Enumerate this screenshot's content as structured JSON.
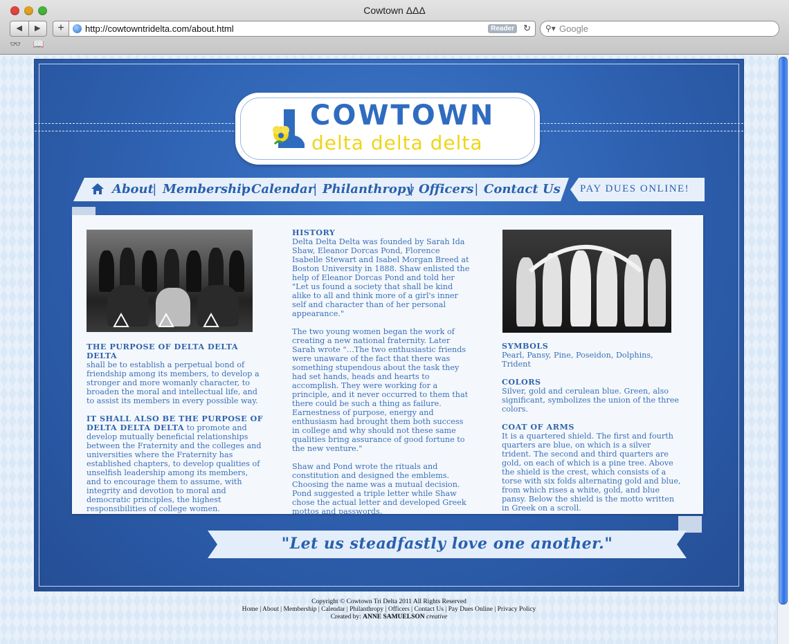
{
  "window": {
    "title": "Cowtown ΔΔΔ"
  },
  "toolbar": {
    "back_label": "◀",
    "forward_label": "▶",
    "add_label": "+",
    "url": "http://cowtowntridelta.com/about.html",
    "reader_label": "Reader",
    "reload_label": "↻",
    "search_placeholder": "Google",
    "bookmarks": [
      "👓",
      "📖"
    ]
  },
  "logo": {
    "line1": "COWTOWN",
    "line2": "delta delta delta"
  },
  "nav": {
    "items": [
      "About",
      "Membership",
      "Calendar",
      "Philanthropy",
      "Officers",
      "Contact Us"
    ],
    "separator": "|",
    "paydues_label": "PAY DUES ONLINE!"
  },
  "left_col": {
    "h1": "THE PURPOSE OF DELTA DELTA DELTA",
    "p1": "shall be to establish a perpetual bond of friendship among its members, to develop a stronger and more womanly character, to broaden the moral and intellectual life, and to assist its members in every possible way.",
    "h2": "IT SHALL ALSO BE THE PURPOSE OF DELTA DELTA DELTA",
    "p2": " to promote and develop mutually beneficial relationships between the Fraternity and the colleges and universities where the Fraternity has established chapters, to develop qualities of unselfish leadership among its members, and to encourage them to assume, with integrity and devotion to moral and democratic principles, the highest responsibilities of college women."
  },
  "mid_col": {
    "h": "HISTORY",
    "p1": "Delta Delta Delta was founded by Sarah Ida Shaw, Eleanor Dorcas Pond, Florence Isabelle Stewart and Isabel Morgan Breed at Boston University in 1888. Shaw enlisted the help of Eleanor Dorcas Pond and told her \"Let us found a society that shall be kind alike to all and think more of a girl's inner self and character than of her personal appearance.\"",
    "p2": "The two young women began the work of creating a new national fraternity. Later Sarah wrote \"…The two enthusiastic friends were unaware of the fact that there was something stupendous about the task they had set hands, heads and hearts to accomplish. They were working for a principle, and it never occurred to them that there could be such a thing as failure. Earnestness of purpose, energy and enthusiasm had brought them both success in college and why should not these same qualities bring assurance of good fortune to the new venture.\"",
    "p3": "Shaw and Pond wrote the rituals and constitution and designed the emblems. Choosing the name was a mutual decision. Pond suggested a triple letter while Shaw chose the actual letter and developed Greek mottos and passwords."
  },
  "right_col": {
    "h1": "SYMBOLS",
    "p1": "Pearl, Pansy, Pine, Poseidon, Dolphins, Trident",
    "h2": "COLORS",
    "p2": "Silver, gold and cerulean blue. Green, also significant, symbolizes the union of the three colors.",
    "h3": "COAT OF ARMS",
    "p3": "It is a quartered shield. The first and fourth quarters are blue, on which is a silver trident. The second and third quarters are gold, on each of which is a pine tree. Above the shield is the crest, which consists of a torse with six folds alternating gold and blue, from which rises a white, gold, and blue pansy. Below the shield is the motto written in Greek on a scroll."
  },
  "banner": {
    "quote": "\"Let us steadfastly love one another.\""
  },
  "footer": {
    "copyright": "Copyright © Cowtown Tri Delta 2011 All Rights Reserved",
    "links": [
      "Home",
      "About",
      "Membership",
      "Calendar",
      "Philanthropy",
      "Officers",
      "Contact Us",
      "Pay Dues Online",
      "Privacy Policy"
    ],
    "created_prefix": "Created by: ",
    "created_name": "ANNE SAMUELSON",
    "created_suffix": " creative"
  },
  "colors": {
    "brand_blue": "#2f6cc0",
    "brand_gold": "#f0d419",
    "panel_blue": "#2d5fae"
  }
}
